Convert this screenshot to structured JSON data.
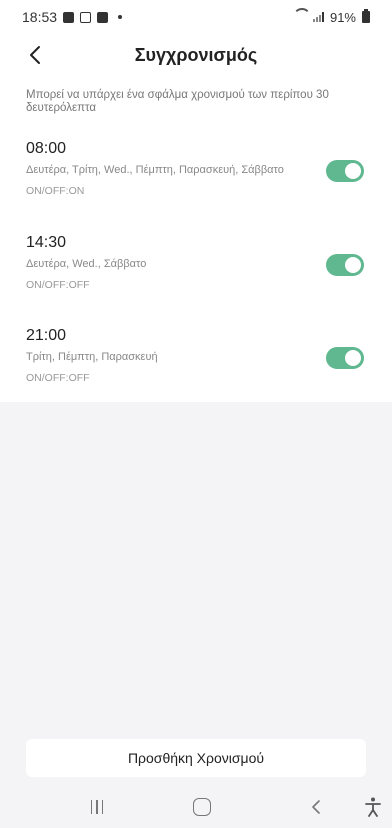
{
  "status": {
    "time": "18:53",
    "battery": "91%"
  },
  "header": {
    "title": "Συγχρονισμός"
  },
  "note": "Μπορεί να υπάρχει ένα σφάλμα χρονισμού των περίπου 30 δευτερόλεπτα",
  "timers": [
    {
      "time": "08:00",
      "days": "Δευτέρα, Τρίτη, Wed., Πέμπτη, Παρασκευή, Σάββατο",
      "onoff": "ON/OFF:ON",
      "enabled": true
    },
    {
      "time": "14:30",
      "days": "Δευτέρα, Wed., Σάββατο",
      "onoff": "ON/OFF:OFF",
      "enabled": true
    },
    {
      "time": "21:00",
      "days": "Τρίτη, Πέμπτη, Παρασκευή",
      "onoff": "ON/OFF:OFF",
      "enabled": true
    }
  ],
  "add_button_label": "Προσθήκη Χρονισμού",
  "colors": {
    "toggle_on": "#5fb890",
    "background": "#f4f4f6"
  },
  "icons": {
    "back": "chevron-left-icon",
    "nav_recents": "recents-icon",
    "nav_home": "home-icon",
    "nav_back": "back-icon",
    "nav_accessibility": "accessibility-icon"
  }
}
